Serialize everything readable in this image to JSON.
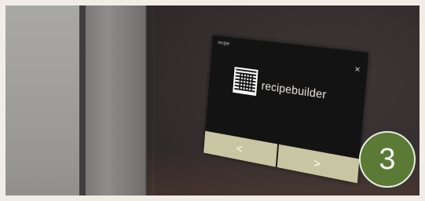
{
  "screen": {
    "header_text": "recipe",
    "brand": "recipebuilder",
    "close_glyph": "×",
    "qr_caption": "",
    "nav": {
      "prev_glyph": "<",
      "next_glyph": ">"
    }
  },
  "badge": {
    "number": "3"
  },
  "icons": [
    "close-icon",
    "qr-code-icon",
    "chevron-left-icon",
    "chevron-right-icon"
  ],
  "colors": {
    "screen": "#141313",
    "nav_button": "#c8c6a2",
    "badge": "#5a7a35",
    "badge_border": "#e7efe0",
    "frame": "#f1ede6"
  }
}
